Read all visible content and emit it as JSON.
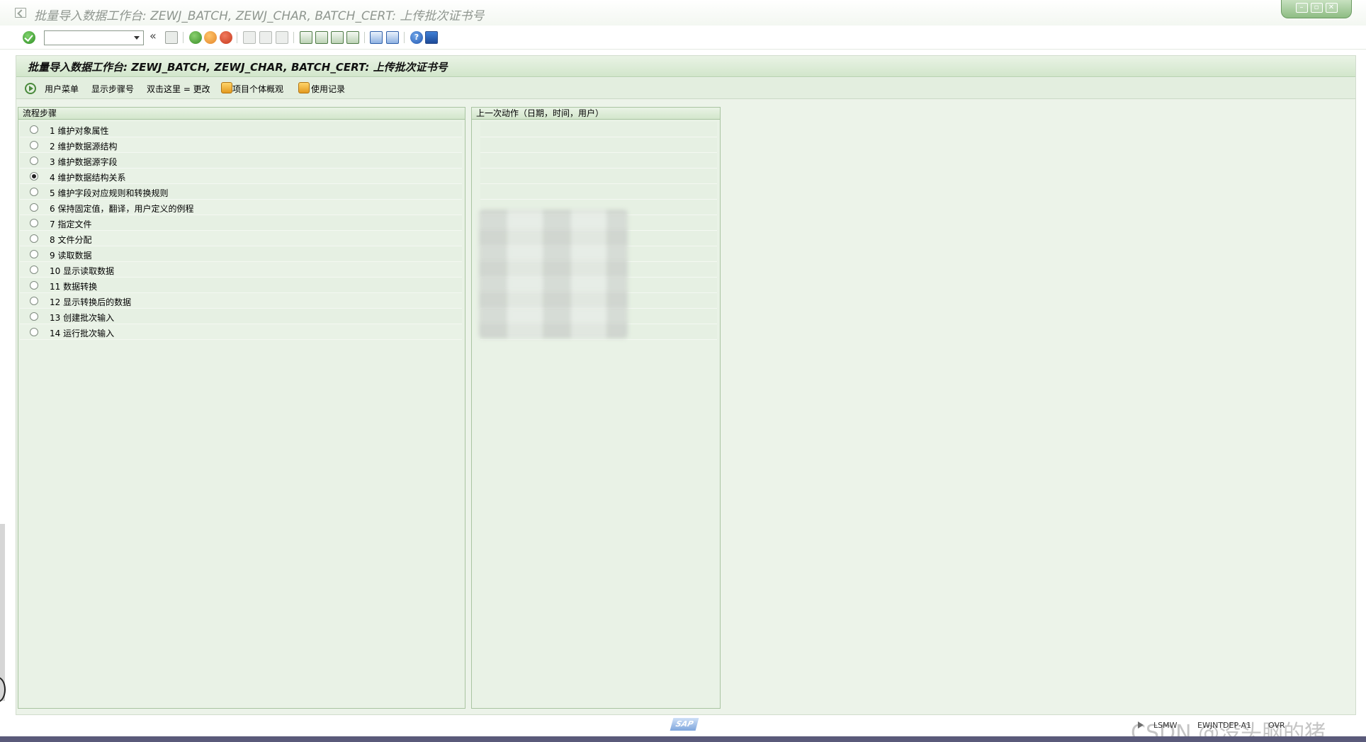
{
  "window": {
    "title": "批量导入数据工作台: ZEWJ_BATCH, ZEWJ_CHAR, BATCH_CERT: 上传批次证书号",
    "controls": [
      "minimize",
      "restore",
      "close"
    ]
  },
  "toolbar": {
    "command_field_value": "",
    "icons": [
      "enter-icon",
      "save-icon",
      "back-icon",
      "exit-icon",
      "cancel-icon",
      "print-icon",
      "find-icon",
      "find-next-icon",
      "first-page-icon",
      "previous-page-icon",
      "next-page-icon",
      "last-page-icon",
      "create-session-icon",
      "generate-shortcut-icon",
      "help-icon",
      "customize-layout-icon"
    ]
  },
  "screen": {
    "title": "批量导入数据工作台: ZEWJ_BATCH, ZEWJ_CHAR, BATCH_CERT: 上传批次证书号",
    "app_toolbar": {
      "user_menu": "用户菜单",
      "show_step_numbers": "显示步骤号",
      "double_click": "双击这里 = 更改",
      "project_overview": "项目个体概观",
      "usage_log": "使用记录"
    }
  },
  "steps_panel": {
    "header": "流程步骤",
    "selected_index": 3,
    "steps": [
      "1 维护对象属性",
      "2 维护数据源结构",
      "3 维护数据源字段",
      "4 维护数据结构关系",
      "5 维护字段对应规则和转换规则",
      "6 保持固定值，翻译，用户定义的例程",
      "7 指定文件",
      "8 文件分配",
      "9 读取数据",
      "10 显示读取数据",
      "11 数据转换",
      "12 显示转换后的数据",
      "13 创建批次输入",
      "14 运行批次输入"
    ]
  },
  "last_action_panel": {
    "header": "上一次动作（日期，时间，用户）"
  },
  "status_bar": {
    "logo": "SAP",
    "system": "LSMW",
    "server": "EWJNTDEP-A1",
    "mode": "OVR",
    "watermark": "CSDN @没头脑的猪"
  }
}
